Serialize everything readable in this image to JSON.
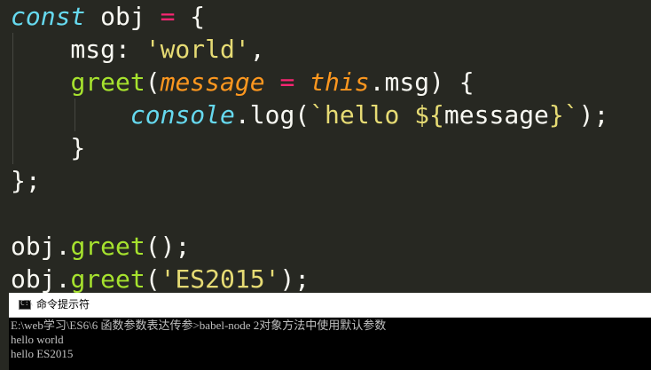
{
  "editor": {
    "lines": [
      {
        "parts": [
          [
            "kw-storage",
            "const"
          ],
          [
            "plain",
            " obj "
          ],
          [
            "op",
            "="
          ],
          [
            "plain",
            " {"
          ]
        ]
      },
      {
        "parts": [
          [
            "plain",
            "    msg: "
          ],
          [
            "str",
            "'world'"
          ],
          [
            "plain",
            ","
          ]
        ]
      },
      {
        "parts": [
          [
            "plain",
            "    "
          ],
          [
            "fn",
            "greet"
          ],
          [
            "plain",
            "("
          ],
          [
            "param",
            "message"
          ],
          [
            "plain",
            " "
          ],
          [
            "op",
            "="
          ],
          [
            "plain",
            " "
          ],
          [
            "this-kw",
            "this"
          ],
          [
            "plain",
            ".msg) {"
          ]
        ]
      },
      {
        "parts": [
          [
            "plain",
            "        "
          ],
          [
            "support",
            "console"
          ],
          [
            "plain",
            ".log("
          ],
          [
            "str",
            "`hello "
          ],
          [
            "str",
            "${"
          ],
          [
            "tmpl-expr",
            "message"
          ],
          [
            "str",
            "}`"
          ],
          [
            "plain",
            ");"
          ]
        ]
      },
      {
        "parts": [
          [
            "plain",
            "    }"
          ]
        ]
      },
      {
        "parts": [
          [
            "plain",
            "};"
          ]
        ]
      },
      {
        "parts": [
          [
            "plain",
            ""
          ]
        ]
      },
      {
        "parts": [
          [
            "plain",
            "obj."
          ],
          [
            "fn",
            "greet"
          ],
          [
            "plain",
            "();"
          ]
        ]
      },
      {
        "parts": [
          [
            "plain",
            "obj."
          ],
          [
            "fn",
            "greet"
          ],
          [
            "plain",
            "("
          ],
          [
            "str",
            "'ES2015'"
          ],
          [
            "plain",
            ");"
          ]
        ]
      }
    ]
  },
  "terminal": {
    "title": "命令提示符",
    "icon": "cmd-window-icon",
    "lines": [
      "E:\\web学习\\ES6\\6 函数参数表达传参>babel-node 2对象方法中使用默认参数",
      "hello world",
      "hello ES2015"
    ]
  },
  "colors": {
    "editor_bg": "#272822",
    "keyword": "#66d9ef",
    "operator": "#f92672",
    "string": "#e6db74",
    "function": "#a6e22e",
    "parameter": "#fd971f",
    "terminal_bg": "#000000",
    "terminal_text": "#c0c0c0"
  }
}
